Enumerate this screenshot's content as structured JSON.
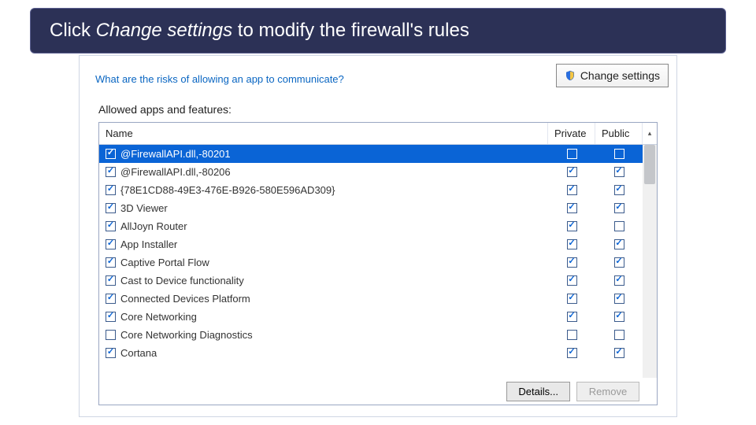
{
  "callout": {
    "prefix": "Click ",
    "emphasis": "Change settings",
    "suffix": " to modify the firewall's rules"
  },
  "panel": {
    "risks_link": "What are the risks of allowing an app to communicate?",
    "change_settings_label": "Change settings",
    "list_label": "Allowed apps and features:",
    "columns": {
      "name": "Name",
      "private": "Private",
      "public": "Public"
    },
    "rows": [
      {
        "enabled": true,
        "name": "@FirewallAPI.dll,-80201",
        "private": false,
        "public": false,
        "selected": true
      },
      {
        "enabled": true,
        "name": "@FirewallAPI.dll,-80206",
        "private": true,
        "public": true
      },
      {
        "enabled": true,
        "name": "{78E1CD88-49E3-476E-B926-580E596AD309}",
        "private": true,
        "public": true
      },
      {
        "enabled": true,
        "name": "3D Viewer",
        "private": true,
        "public": true
      },
      {
        "enabled": true,
        "name": "AllJoyn Router",
        "private": true,
        "public": false
      },
      {
        "enabled": true,
        "name": "App Installer",
        "private": true,
        "public": true
      },
      {
        "enabled": true,
        "name": "Captive Portal Flow",
        "private": true,
        "public": true
      },
      {
        "enabled": true,
        "name": "Cast to Device functionality",
        "private": true,
        "public": true
      },
      {
        "enabled": true,
        "name": "Connected Devices Platform",
        "private": true,
        "public": true
      },
      {
        "enabled": true,
        "name": "Core Networking",
        "private": true,
        "public": true
      },
      {
        "enabled": false,
        "name": "Core Networking Diagnostics",
        "private": false,
        "public": false
      },
      {
        "enabled": true,
        "name": "Cortana",
        "private": true,
        "public": true
      }
    ],
    "footer": {
      "details": "Details...",
      "remove": "Remove"
    }
  }
}
